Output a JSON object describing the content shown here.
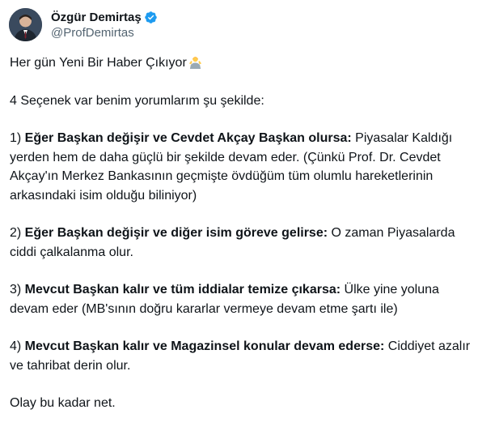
{
  "author": {
    "display_name": "Özgür Demirtaş",
    "handle": "@ProfDemirtas",
    "verified_icon": "verified-badge-icon",
    "badge_color": "#1d9bf0"
  },
  "tweet": {
    "intro": "Her gün Yeni Bir Haber Çıkıyor",
    "intro_emoji": "person-shrugging-emoji",
    "setup": "4 Seçenek var benim yorumlarım şu şekilde:",
    "option1": {
      "num": "1) ",
      "bold": "Eğer Başkan değişir ve Cevdet Akçay Başkan olursa:",
      "text": " Piyasalar Kaldığı yerden hem de daha güçlü bir şekilde devam eder. (Çünkü Prof. Dr. Cevdet Akçay'ın Merkez Bankasının geçmişte övdüğüm tüm olumlu hareketlerinin arkasındaki isim olduğu biliniyor)"
    },
    "option2": {
      "num": "2) ",
      "bold": "Eğer Başkan değişir ve diğer isim göreve gelirse:",
      "text": " O zaman Piyasalarda ciddi çalkalanma olur."
    },
    "option3": {
      "num": "3) ",
      "bold": "Mevcut Başkan kalır ve tüm iddialar temize çıkarsa:",
      "text": " Ülke yine yoluna devam eder (MB'sının doğru kararlar vermeye devam etme şartı ile)"
    },
    "option4": {
      "num": "4) ",
      "bold": "Mevcut Başkan kalır ve Magazinsel konular devam ederse:",
      "text": " Ciddiyet azalır ve tahribat derin olur."
    },
    "closing": "Olay bu kadar net."
  }
}
